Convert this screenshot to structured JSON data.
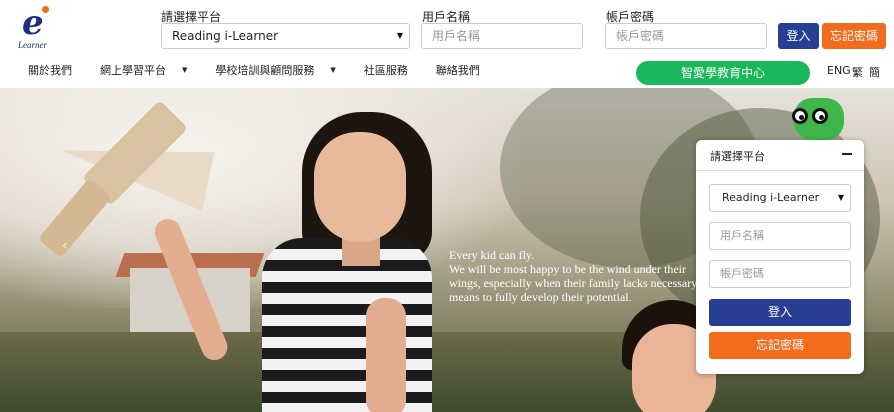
{
  "logo": {
    "brand_text": "Learner"
  },
  "header": {
    "platform_label": "請選擇平台",
    "platform_value": "Reading i-Learner",
    "username_label": "用戶名稱",
    "username_placeholder": "用戶名稱",
    "password_label": "帳戶密碼",
    "password_placeholder": "帳戶密碼",
    "login_label": "登入",
    "forgot_label": "忘記密碼"
  },
  "nav": {
    "items": [
      {
        "label": "關於我們"
      },
      {
        "label": "網上學習平台"
      },
      {
        "label": "學校培訓與顧問服務"
      },
      {
        "label": "社區服務"
      },
      {
        "label": "聯絡我們"
      }
    ],
    "center_button": "智愛學教育中心",
    "languages": [
      "ENG",
      "繁",
      "簡"
    ]
  },
  "hero": {
    "quote": "Every kid can fly.\nWe will be most happy to be the wind under their\nwings, especially when their family lacks necessary\nmeans to fully develop their potential."
  },
  "panel": {
    "title": "請選擇平台",
    "platform_value": "Reading i-Learner",
    "username_placeholder": "用戶名稱",
    "password_placeholder": "帳戶密碼",
    "login_label": "登入",
    "forgot_label": "忘記密碼"
  },
  "colors": {
    "brand_navy": "#1e2f7a",
    "login_blue": "#283e92",
    "forgot_orange": "#f36b1c",
    "center_green": "#1ab85a"
  }
}
